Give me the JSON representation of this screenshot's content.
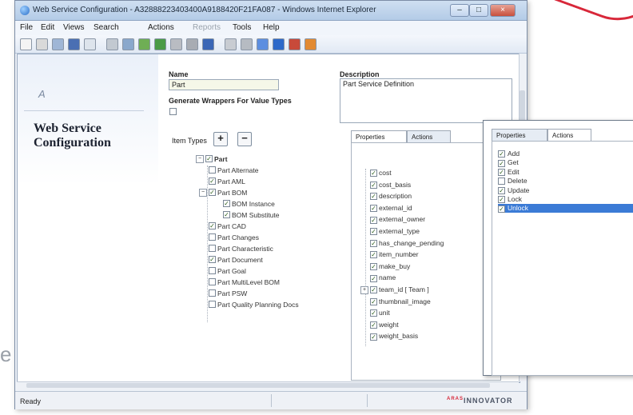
{
  "window": {
    "title": "Web Service Configuration - A32888223403400A9188420F21FA087 - Windows Internet Explorer",
    "controls": {
      "minimize": "–",
      "maximize": "□",
      "close": "×"
    }
  },
  "menu": [
    {
      "label": "File",
      "disabled": false
    },
    {
      "label": "Edit",
      "disabled": false
    },
    {
      "label": "Views",
      "disabled": false
    },
    {
      "label": "Search",
      "disabled": false
    },
    {
      "label": "Actions",
      "disabled": false
    },
    {
      "label": "Reports",
      "disabled": true
    },
    {
      "label": "Tools",
      "disabled": false
    },
    {
      "label": "Help",
      "disabled": false
    }
  ],
  "toolbar_icons": [
    "new-icon",
    "open-icon",
    "copy-icon",
    "save-icon",
    "print-icon",
    "refresh-icon",
    "view-icon",
    "folder-icon",
    "export-icon",
    "lock-icon",
    "unlock-icon",
    "undo-icon",
    "tools-icon",
    "list-icon",
    "grid-icon",
    "info-icon",
    "wand-icon",
    "settings-icon"
  ],
  "left_panel": {
    "logo_text": "A",
    "title": "Web Service Configuration"
  },
  "form": {
    "name_label": "Name",
    "name_value": "Part",
    "generate_label": "Generate Wrappers For Value Types",
    "description_label": "Description",
    "description_value": "Part Service Definition",
    "item_types_label": "Item Types",
    "add": "+",
    "remove": "−"
  },
  "tree": [
    {
      "label": "Part",
      "level": 0,
      "checked": true,
      "expander": "−",
      "bold": true
    },
    {
      "label": "Part Alternate",
      "level": 1,
      "checked": false
    },
    {
      "label": "Part AML",
      "level": 1,
      "checked": true
    },
    {
      "label": "Part BOM",
      "level": 1,
      "checked": true,
      "expander": "−"
    },
    {
      "label": "BOM Instance",
      "level": 2,
      "checked": true
    },
    {
      "label": "BOM Substitute",
      "level": 2,
      "checked": true
    },
    {
      "label": "Part CAD",
      "level": 1,
      "checked": true
    },
    {
      "label": "Part Changes",
      "level": 1,
      "checked": false
    },
    {
      "label": "Part Characteristic",
      "level": 1,
      "checked": false
    },
    {
      "label": "Part Document",
      "level": 1,
      "checked": true
    },
    {
      "label": "Part Goal",
      "level": 1,
      "checked": false
    },
    {
      "label": "Part MultiLevel BOM",
      "level": 1,
      "checked": false
    },
    {
      "label": "Part PSW",
      "level": 1,
      "checked": false
    },
    {
      "label": "Part Quality Planning Docs",
      "level": 1,
      "checked": false
    }
  ],
  "properties_panel": {
    "tabs": [
      {
        "label": "Properties",
        "active": true
      },
      {
        "label": "Actions",
        "active": false
      }
    ],
    "items": [
      {
        "label": "cost",
        "checked": true
      },
      {
        "label": "cost_basis",
        "checked": true
      },
      {
        "label": "description",
        "checked": true
      },
      {
        "label": "external_id",
        "checked": true
      },
      {
        "label": "external_owner",
        "checked": true
      },
      {
        "label": "external_type",
        "checked": true
      },
      {
        "label": "has_change_pending",
        "checked": true
      },
      {
        "label": "item_number",
        "checked": true
      },
      {
        "label": "make_buy",
        "checked": true
      },
      {
        "label": "name",
        "checked": true
      },
      {
        "label": "team_id [ Team ]",
        "checked": true,
        "expander": "+"
      },
      {
        "label": "thumbnail_image",
        "checked": true
      },
      {
        "label": "unit",
        "checked": true
      },
      {
        "label": "weight",
        "checked": true
      },
      {
        "label": "weight_basis",
        "checked": true
      }
    ]
  },
  "actions_panel": {
    "tabs": [
      {
        "label": "Properties",
        "active": false
      },
      {
        "label": "Actions",
        "active": true
      }
    ],
    "items": [
      {
        "label": "Add",
        "checked": true
      },
      {
        "label": "Get",
        "checked": true
      },
      {
        "label": "Edit",
        "checked": true
      },
      {
        "label": "Delete",
        "checked": false
      },
      {
        "label": "Update",
        "checked": true
      },
      {
        "label": "Lock",
        "checked": true
      },
      {
        "label": "Unlock",
        "checked": true,
        "selected": true
      }
    ]
  },
  "status": {
    "text": "Ready",
    "brand_prefix": "ARAS",
    "brand": "INNOVATOR"
  },
  "background": {
    "letter": "e"
  },
  "colors": {
    "accent": "#d8283a",
    "selection": "#3b7bd6",
    "titlebar": "#b3cbe7"
  }
}
